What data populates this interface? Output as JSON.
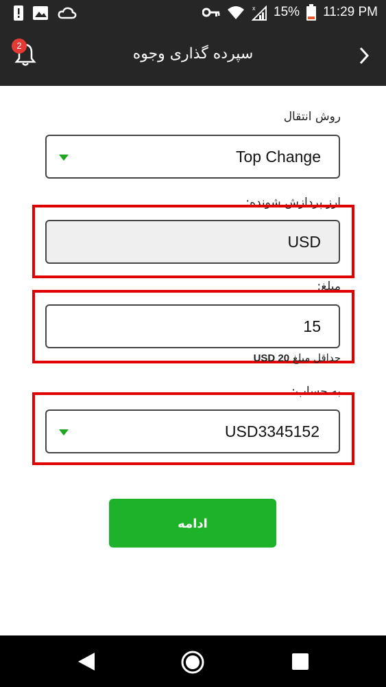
{
  "status_bar": {
    "battery": "15%",
    "time": "11:29 PM"
  },
  "header": {
    "title": "سپرده گذاری وجوه",
    "notification_count": "2"
  },
  "form": {
    "transfer_method_label": "روش انتقال",
    "transfer_method_value": "Top Change",
    "currency_label": "ارز پردازش شونده:",
    "currency_value": "USD",
    "amount_label": "مبلغ:",
    "amount_value": "15",
    "minimum_amount_prefix": "حداقل مبلغ",
    "minimum_amount_value": "USD 20",
    "account_label": "به حساب:",
    "account_value": "USD3345152"
  },
  "continue_button": "ادامه",
  "colors": {
    "accent_green": "#1eb12a",
    "header_bg": "#262626",
    "highlight_red": "#e00000",
    "badge_red": "#e53935"
  },
  "icons": [
    "warning-icon",
    "image-icon",
    "cloud-icon",
    "key-icon",
    "wifi-icon",
    "signal-icon",
    "battery-icon",
    "bell-icon",
    "chevron-right-icon",
    "dropdown-arrow-icon",
    "nav-back-icon",
    "nav-home-icon",
    "nav-recents-icon"
  ]
}
